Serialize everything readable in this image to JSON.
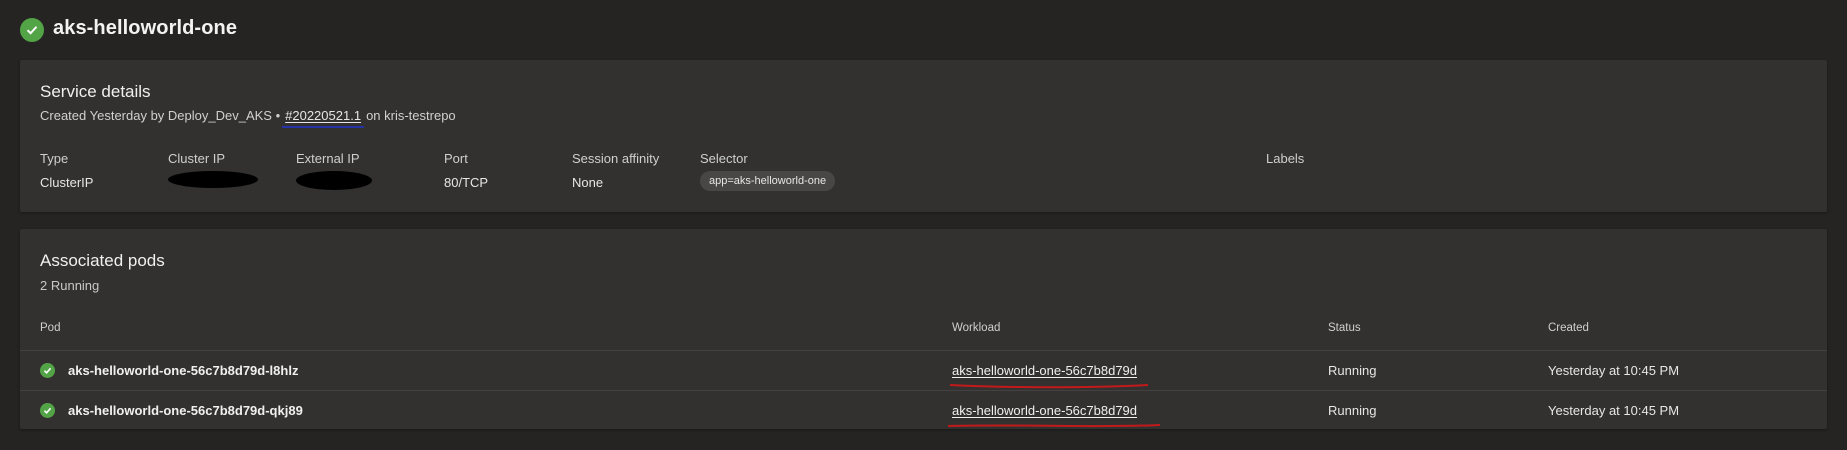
{
  "header": {
    "title": "aks-helloworld-one",
    "status_icon": "check-circle-icon",
    "status_color": "#53a447"
  },
  "service_details": {
    "title": "Service details",
    "created_prefix": "Created Yesterday by Deploy_Dev_AKS  •",
    "run_link": "#20220521.1",
    "created_suffix": "on kris-testrepo",
    "fields": {
      "type": {
        "label": "Type",
        "value": "ClusterIP"
      },
      "cluster_ip": {
        "label": "Cluster IP"
      },
      "external_ip": {
        "label": "External IP"
      },
      "port": {
        "label": "Port",
        "value": "80/TCP"
      },
      "session_affinity": {
        "label": "Session affinity",
        "value": "None"
      },
      "selector": {
        "label": "Selector",
        "value": "app=aks-helloworld-one"
      },
      "labels": {
        "label": "Labels"
      }
    }
  },
  "associated_pods": {
    "title": "Associated pods",
    "count_text": "2 Running",
    "columns": {
      "pod": "Pod",
      "workload": "Workload",
      "status": "Status",
      "created": "Created"
    },
    "rows": [
      {
        "pod": "aks-helloworld-one-56c7b8d79d-l8hlz",
        "workload": "aks-helloworld-one-56c7b8d79d",
        "status": "Running",
        "created": "Yesterday at 10:45 PM"
      },
      {
        "pod": "aks-helloworld-one-56c7b8d79d-qkj89",
        "workload": "aks-helloworld-one-56c7b8d79d",
        "status": "Running",
        "created": "Yesterday at 10:45 PM"
      }
    ]
  },
  "colors": {
    "background": "#252423",
    "card": "#323130",
    "success": "#53a447",
    "link_underline_annotation": "#2633a6",
    "workload_annotation": "#c21a1a"
  }
}
